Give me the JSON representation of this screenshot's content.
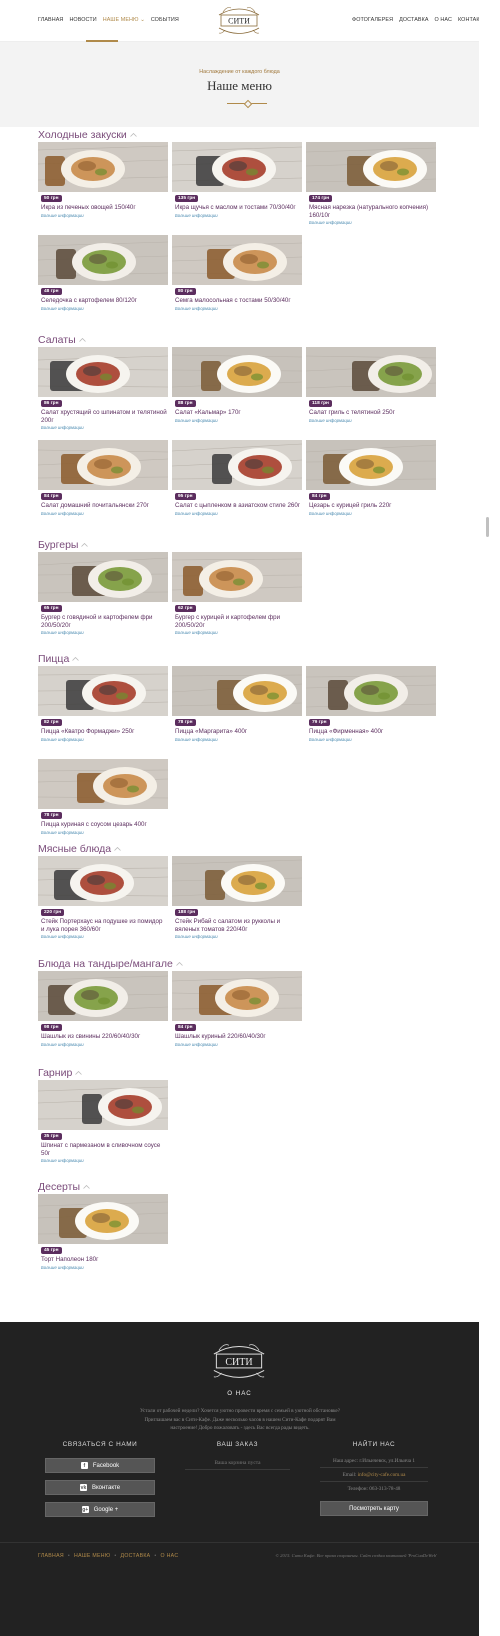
{
  "nav": {
    "left": [
      "Главная",
      "Новости",
      "Наше меню",
      "События"
    ],
    "active_index": 2,
    "right": [
      "Фотогалерея",
      "Доставка",
      "О нас",
      "Контакты"
    ]
  },
  "logo_text": "СИТИ",
  "hero": {
    "subtitle": "Наслаждение от каждого блюда",
    "title": "Наше меню"
  },
  "more_label": "Больше информации",
  "sections": [
    {
      "title": "Холодные закуски",
      "items": [
        {
          "price": "50 грн",
          "name": "Икра из печеных овощей 150/40г"
        },
        {
          "price": "135 грн",
          "name": "Икра щучья с маслом и тостами 70/30/40г"
        },
        {
          "price": "174 грн",
          "name": "Мясная нарезка (натурального копчения) 160/10г"
        },
        {
          "price": "48 грн",
          "name": "Селедочка с картофелем 80/120г"
        },
        {
          "price": "80 грн",
          "name": "Семга малосольная с тостами 50/30/40г"
        }
      ]
    },
    {
      "title": "Салаты",
      "items": [
        {
          "price": "86 грн",
          "name": "Салат хрустящий со шпинатом и телятиной 200г"
        },
        {
          "price": "88 грн",
          "name": "Салат «Кальмар» 170г"
        },
        {
          "price": "118 грн",
          "name": "Салат гриль с телятиной 250г"
        },
        {
          "price": "84 грн",
          "name": "Салат домашний почитальянски 270г"
        },
        {
          "price": "95 грн",
          "name": "Салат с цыпленком в азиатском стиле 260г"
        },
        {
          "price": "84 грн",
          "name": "Цезарь с курицей гриль 220г"
        }
      ]
    },
    {
      "title": "Бургеры",
      "items": [
        {
          "price": "65 грн",
          "name": "Бургер с говядиной и картофелем фри 200/50/20г"
        },
        {
          "price": "62 грн",
          "name": "Бургер с курицей и картофелем фри 200/50/20г"
        }
      ]
    },
    {
      "title": "Пицца",
      "items": [
        {
          "price": "82 грн",
          "name": "Пицца «Кватро Формаджи» 250г"
        },
        {
          "price": "78 грн",
          "name": "Пицца «Маргарита» 400г"
        },
        {
          "price": "79 грн",
          "name": "Пицца «Фирменная» 400г"
        },
        {
          "price": "78 грн",
          "name": "Пицца куриная с соусом цезарь 400г"
        }
      ]
    },
    {
      "title": "Мясные блюда",
      "items": [
        {
          "price": "220 грн",
          "name": "Стейк Портерхаус на подушке из помидор и лука порея 360/60г"
        },
        {
          "price": "188 грн",
          "name": "Стейк Рибай с салатом из рукколы и вяленых томатов 220/40г"
        }
      ]
    },
    {
      "title": "Блюда на тандыре/мангале",
      "items": [
        {
          "price": "98 грн",
          "name": "Шашлык из свинины 220/60/40/30г"
        },
        {
          "price": "84 грн",
          "name": "Шашлык куриный 220/60/40/30г"
        }
      ]
    },
    {
      "title": "Гарнир",
      "items": [
        {
          "price": "35 грн",
          "name": "Шпинат с пармезаном в сливочном соусе 50г"
        }
      ]
    },
    {
      "title": "Десерты",
      "items": [
        {
          "price": "45 грн",
          "name": "Торт Наполеон 180г"
        }
      ]
    }
  ],
  "footer": {
    "about_title": "О НАС",
    "about_text": "Устали от рабочей недели? Хочется уютно провести время с семьей в уютной обстановке? Приглашаем вас в Сити-Кафе. Даже несколько часов в нашем Сити-Кафе подарят Вам настроение! Добро пожаловать - здесь Вас всегда рады видеть.",
    "social_title": "СВЯЗАТЬСЯ С НАМИ",
    "social": [
      "Facebook",
      "Вконтакте",
      "Google +"
    ],
    "order_title": "ВАШ ЗАКАЗ",
    "order_text": "Ваша корзина пуста",
    "find_title": "НАЙТИ НАС",
    "address": "Наш адрес: г.Ильичевск, ул.Ильича 1",
    "email_label": "Email:",
    "email": "info@city-cafe.com.ua",
    "phone": "Телефон: 063-313-78-48",
    "map_button": "Посмотреть карту",
    "bottom_nav": [
      "Главная",
      "Наше меню",
      "Доставка",
      "О нас"
    ],
    "copyright": "© 2015. Сити Кафе. Все права сохранены. Сайт создан компанией 'ProCuaDeWeb'"
  }
}
